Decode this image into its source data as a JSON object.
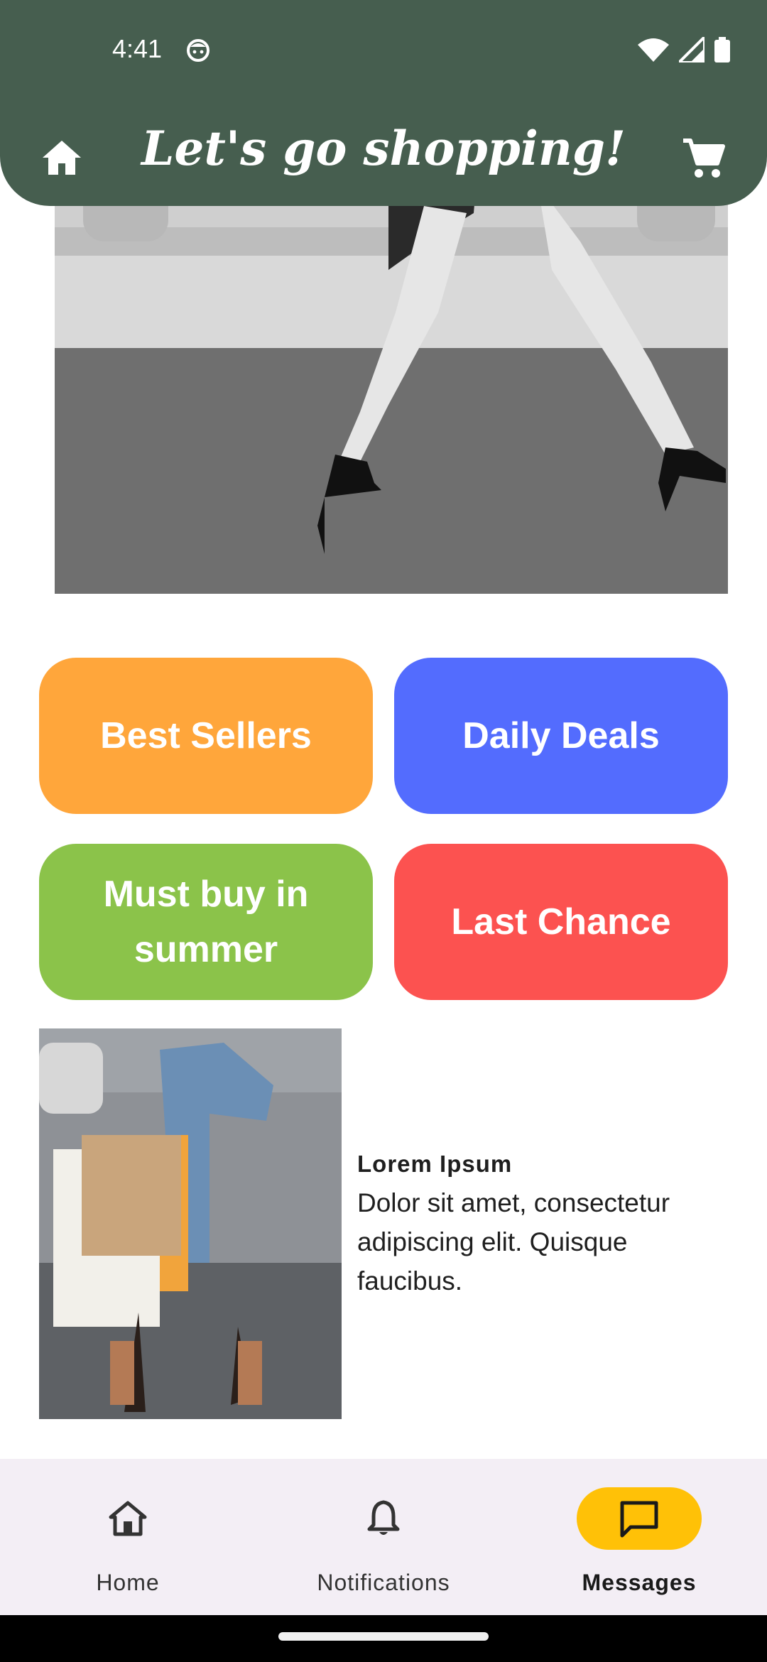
{
  "status": {
    "time": "4:41"
  },
  "app_bar": {
    "title": "Let's go shopping!"
  },
  "categories": [
    {
      "label": "Best Sellers",
      "color": "#ffa63b"
    },
    {
      "label": "Daily Deals",
      "color": "#536cfe"
    },
    {
      "label": "Must buy in summer",
      "color": "#8bc34a"
    },
    {
      "label": "Last Chance",
      "color": "#fc5250"
    }
  ],
  "card": {
    "title": "Lorem Ipsum",
    "body": "Dolor sit amet, consectetur adipiscing elit. Quisque faucibus."
  },
  "bottom_nav": {
    "items": [
      {
        "label": "Home",
        "icon": "home-outline-icon"
      },
      {
        "label": "Notifications",
        "icon": "bell-icon"
      },
      {
        "label": "Messages",
        "icon": "chat-bubble-icon"
      }
    ],
    "active": "Messages",
    "active_color": "#ffc107"
  },
  "theme": {
    "app_bar_color": "#465e4f",
    "nav_background": "#f3eef5"
  }
}
